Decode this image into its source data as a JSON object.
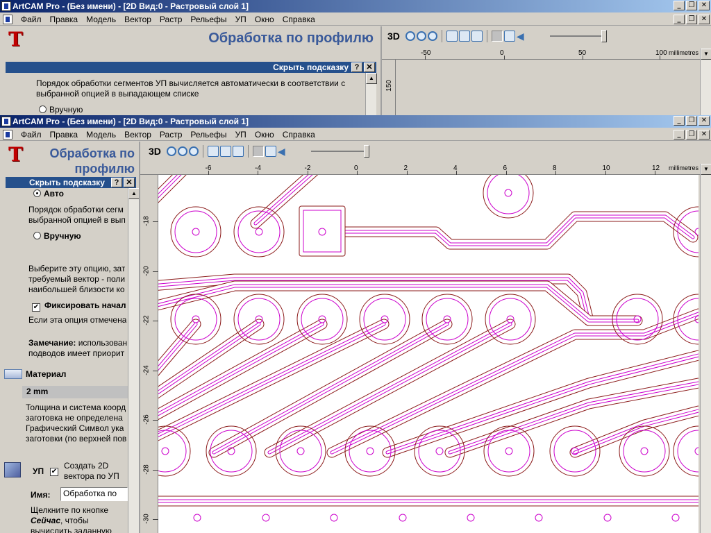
{
  "back_window": {
    "title": "ArtCAM Pro - (Без имени) - [2D Вид:0 - Растровый слой 1]",
    "menu": [
      "Файл",
      "Правка",
      "Модель",
      "Вектор",
      "Растр",
      "Рельефы",
      "УП",
      "Окно",
      "Справка"
    ],
    "panel_title": "Обработка по профилю",
    "hint_label": "Скрыть подсказку",
    "hint_help": "?",
    "hint_close": "✕",
    "text_1": "Порядок обработки сегментов УП вычисляется автоматически в соответствии с",
    "text_2": "выбранной опцией в выпадающем списке",
    "radio_manual": "Вручную",
    "toolbar_3d": "3D",
    "ruler_ticks": [
      "-50",
      "0",
      "50",
      "100"
    ],
    "ruler_units": "millimetres",
    "ruler_v_tick": "150"
  },
  "front_window": {
    "title": "ArtCAM Pro - (Без имени) - [2D Вид:0 - Растровый слой 1]",
    "menu": [
      "Файл",
      "Правка",
      "Модель",
      "Вектор",
      "Растр",
      "Рельефы",
      "УП",
      "Окно",
      "Справка"
    ],
    "panel_title_1": "Обработка по",
    "panel_title_2": "профилю",
    "hint_label": "Скрыть подсказку",
    "hint_help": "?",
    "hint_close": "✕",
    "radio_auto": "Авто",
    "text_order_1": "Порядок обработки сегм",
    "text_order_2": "выбранной опцией в вып",
    "radio_manual": "Вручную",
    "text_select_1": "Выберите эту опцию, зат",
    "text_select_2": "требуемый вектор - поли",
    "text_select_3": "наибольшей близости ко",
    "check_fix": "Фиксировать начал",
    "text_if_1": "Если эта опция отмечена",
    "note_bold": "Замечание:",
    "note_rest": " использован",
    "note_2": "подводов имеет приорит",
    "material_label": "Материал",
    "material_value": "2 mm",
    "mat_text_1": "Толщина и система коорд",
    "mat_text_2": "заготовка не определена",
    "mat_text_3": "Графический Символ ука",
    "mat_text_4": "заготовки (по верхней пов",
    "up_label": "УП",
    "create_vec_1": "Создать 2D",
    "create_vec_2": "вектора по УП",
    "name_label": "Имя:",
    "name_value": "Обработка по",
    "click_1": "Щелкните по кнопке",
    "click_now": "Сейчас",
    "click_2_rest": ", чтобы",
    "click_3": "вычислить заданную",
    "toolbar_3d": "3D",
    "ruler_h_ticks": [
      "-6",
      "-4",
      "-2",
      "0",
      "2",
      "4",
      "6",
      "8",
      "10",
      "12"
    ],
    "ruler_units": "millimetres",
    "ruler_v_ticks": [
      "-18",
      "-20",
      "-22",
      "-24",
      "-26",
      "-28",
      "-30"
    ]
  },
  "colors": {
    "title_start": "#0a246a",
    "title_end": "#a6caf0",
    "hint_bar": "#25508c",
    "panel_title": "#3a5a9a",
    "toolpath_outer": "#8b1a1a",
    "toolpath_inner": "#cc00cc"
  }
}
